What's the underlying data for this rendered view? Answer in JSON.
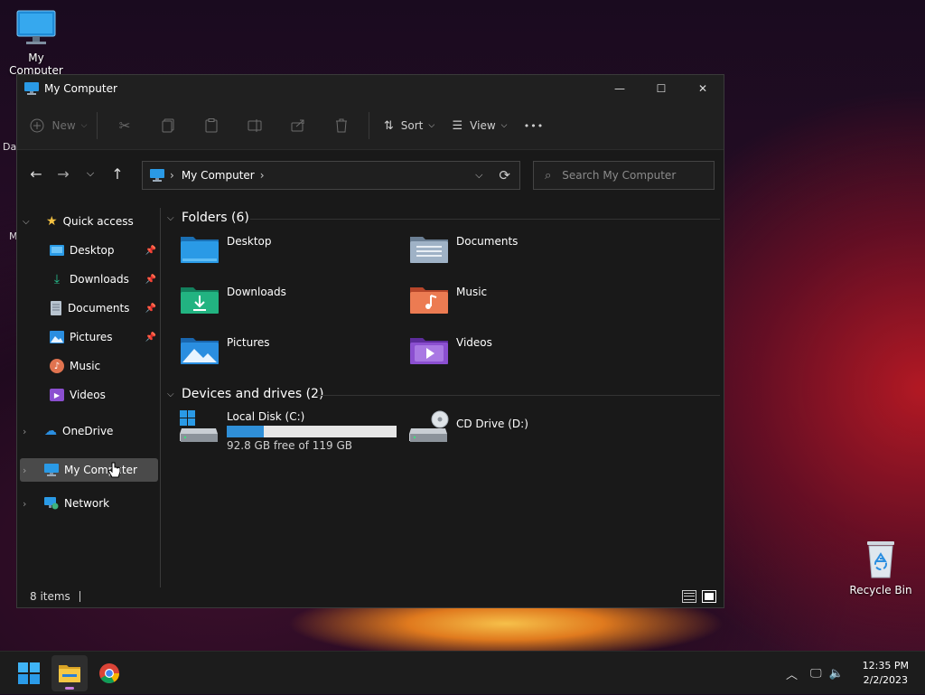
{
  "desktop": {
    "icons": [
      {
        "label": "My Computer"
      },
      {
        "label": "Recycle Bin"
      }
    ],
    "partial_labels": [
      "Dat",
      "M"
    ]
  },
  "window": {
    "title": "My Computer",
    "controls": {
      "minimize": "—",
      "maximize": "☐",
      "close": "✕"
    }
  },
  "toolbar": {
    "new_label": "New",
    "sort_label": "Sort",
    "view_label": "View",
    "more_label": "•••"
  },
  "address": {
    "location": "My Computer"
  },
  "search": {
    "placeholder": "Search My Computer"
  },
  "sidebar": {
    "quick_access": "Quick access",
    "items": [
      {
        "label": "Desktop",
        "pinned": true
      },
      {
        "label": "Downloads",
        "pinned": true
      },
      {
        "label": "Documents",
        "pinned": true
      },
      {
        "label": "Pictures",
        "pinned": true
      },
      {
        "label": "Music",
        "pinned": false
      },
      {
        "label": "Videos",
        "pinned": false
      }
    ],
    "onedrive": "OneDrive",
    "my_computer": "My Computer",
    "network": "Network"
  },
  "content": {
    "folders_header": "Folders (6)",
    "folders": [
      {
        "name": "Desktop",
        "icon": "desktop-folder-icon",
        "color": "#1f8fdc"
      },
      {
        "name": "Documents",
        "icon": "documents-folder-icon",
        "color": "#8aa4bf"
      },
      {
        "name": "Downloads",
        "icon": "downloads-folder-icon",
        "color": "#1fa57a"
      },
      {
        "name": "Music",
        "icon": "music-folder-icon",
        "color": "#e26a45"
      },
      {
        "name": "Pictures",
        "icon": "pictures-folder-icon",
        "color": "#2a8ee0"
      },
      {
        "name": "Videos",
        "icon": "videos-folder-icon",
        "color": "#8b4fd0"
      }
    ],
    "drives_header": "Devices and drives (2)",
    "drives": [
      {
        "name": "Local Disk (C:)",
        "free_text": "92.8 GB free of 119 GB",
        "used_fraction": 0.22
      },
      {
        "name": "CD Drive (D:)"
      }
    ]
  },
  "status": {
    "items_count": "8 items"
  },
  "taskbar": {
    "time": "12:35 PM",
    "date": "2/2/2023"
  },
  "colors": {
    "accent": "#2f8fd8",
    "window_bg": "#191919",
    "taskbar_bg": "#1c1c1c",
    "selection": "#4a4a4a"
  }
}
